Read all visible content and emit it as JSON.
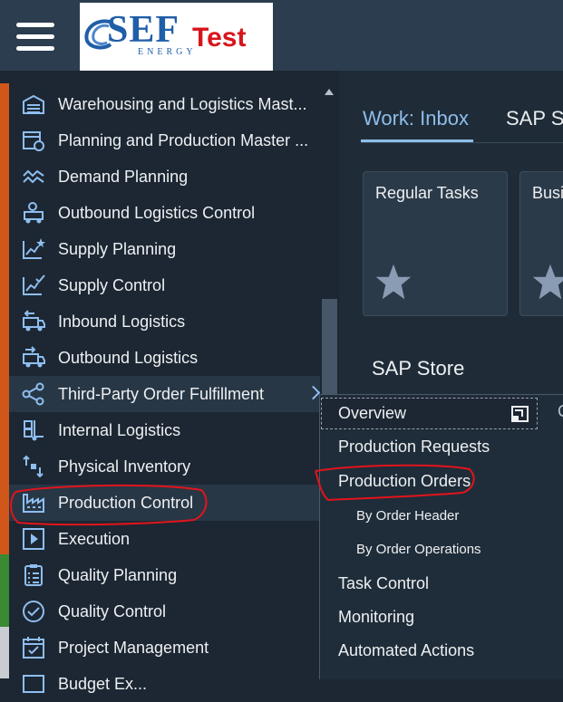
{
  "header": {
    "menu_icon": "hamburger-icon",
    "logo": {
      "name": "SEF",
      "subtitle": "ENERGY",
      "env_label": "Test"
    }
  },
  "sidebar": {
    "items": [
      {
        "label": "Warehousing and Logistics Mast...",
        "icon": "warehouse-icon"
      },
      {
        "label": "Planning and Production Master ...",
        "icon": "calendar-clock-icon"
      },
      {
        "label": "Demand Planning",
        "icon": "demand-wave-icon"
      },
      {
        "label": "Outbound Logistics Control",
        "icon": "forklift-icon"
      },
      {
        "label": "Supply Planning",
        "icon": "chart-star-icon"
      },
      {
        "label": "Supply Control",
        "icon": "chart-check-icon"
      },
      {
        "label": "Inbound Logistics",
        "icon": "truck-in-icon"
      },
      {
        "label": "Outbound Logistics",
        "icon": "truck-out-icon"
      },
      {
        "label": "Third-Party Order Fulfillment",
        "icon": "share-icon"
      },
      {
        "label": "Internal Logistics",
        "icon": "hand-truck-icon"
      },
      {
        "label": "Physical Inventory",
        "icon": "inventory-arrows-icon"
      },
      {
        "label": "Production Control",
        "icon": "factory-icon"
      },
      {
        "label": "Execution",
        "icon": "play-icon"
      },
      {
        "label": "Quality Planning",
        "icon": "checklist-icon"
      },
      {
        "label": "Quality Control",
        "icon": "check-circle-icon"
      },
      {
        "label": "Project Management",
        "icon": "project-calendar-icon"
      },
      {
        "label": "Budget Ex...",
        "icon": "budget-icon"
      }
    ]
  },
  "tabs": [
    {
      "label": "Work: Inbox"
    },
    {
      "label": "SAP S"
    }
  ],
  "tiles": [
    {
      "title": "Regular Tasks"
    },
    {
      "title": "Busi"
    }
  ],
  "section": {
    "title": "SAP Store"
  },
  "submenu": {
    "items": [
      {
        "label": "Overview"
      },
      {
        "label": "Production Requests"
      },
      {
        "label": "Production Orders"
      },
      {
        "label": "By Order Header"
      },
      {
        "label": "By Order Operations"
      },
      {
        "label": "Task Control"
      },
      {
        "label": "Monitoring"
      },
      {
        "label": "Automated Actions"
      }
    ],
    "edge_glyph": "C"
  },
  "colors": {
    "accent_active": "#8ebde9",
    "annotation": "#e3141b",
    "brand_blue": "#1f5ea8",
    "brand_red": "#d8141b",
    "sidebar_accent_orange": "#d1561a",
    "sidebar_accent_green": "#3a8a34"
  }
}
